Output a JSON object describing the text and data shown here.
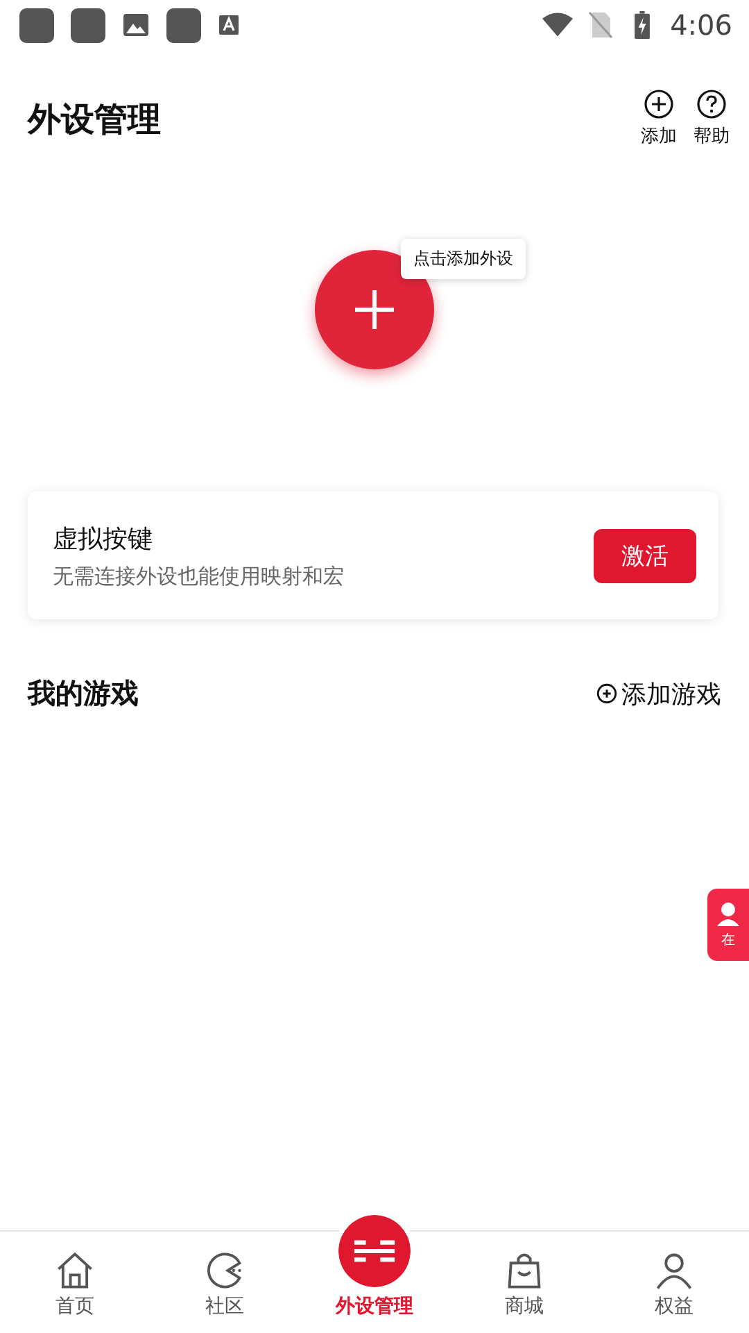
{
  "status_bar": {
    "time": "4:06"
  },
  "header": {
    "title": "外设管理",
    "actions": [
      {
        "label": "添加"
      },
      {
        "label": "帮助"
      }
    ]
  },
  "hero": {
    "tooltip": "点击添加外设"
  },
  "virtual_keys": {
    "title": "虚拟按键",
    "subtitle": "无需连接外设也能使用映射和宏",
    "button": "激活"
  },
  "games": {
    "title": "我的游戏",
    "add": "添加游戏"
  },
  "float_tab": {
    "label": "在"
  },
  "nav": [
    {
      "label": "首页",
      "selected": false
    },
    {
      "label": "社区",
      "selected": false
    },
    {
      "label": "外设管理",
      "selected": true
    },
    {
      "label": "商城",
      "selected": false
    },
    {
      "label": "权益",
      "selected": false
    }
  ]
}
